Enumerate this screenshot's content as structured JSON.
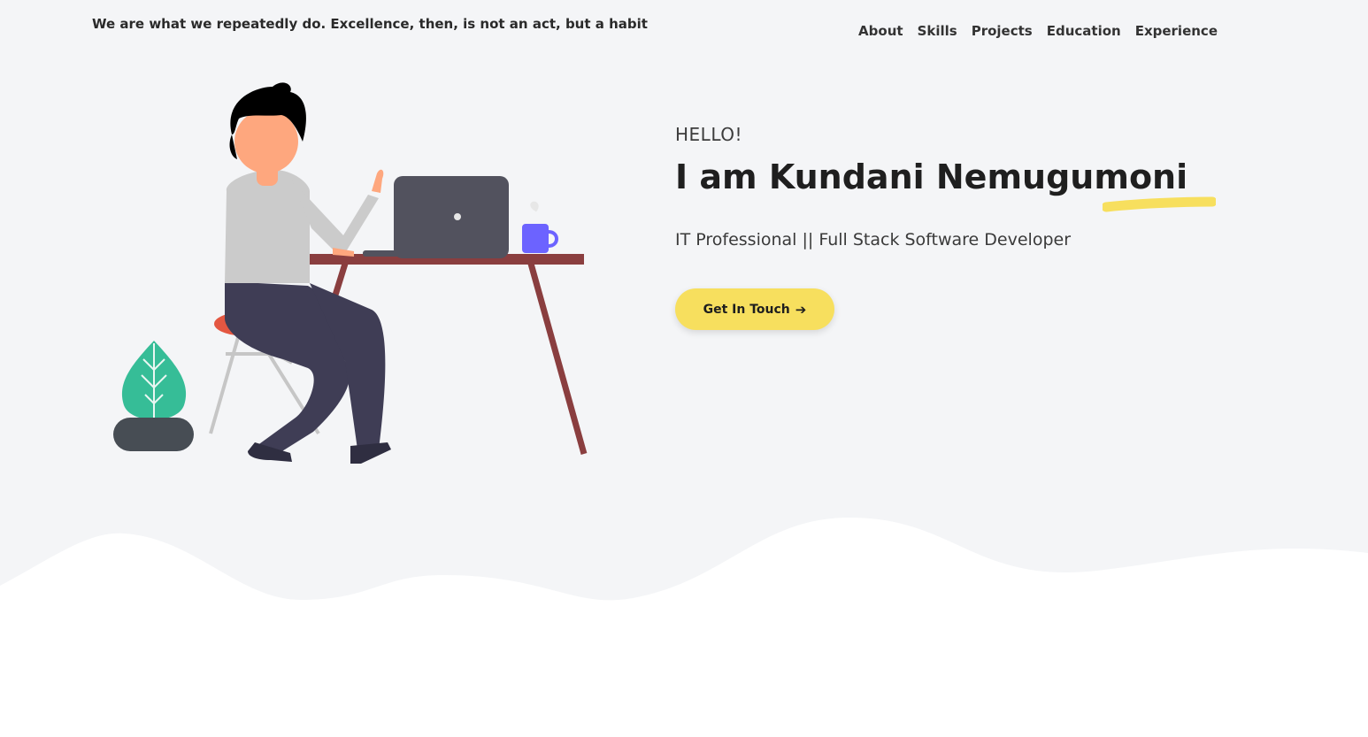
{
  "header": {
    "quote": "We are what we repeatedly do. Excellence, then, is not an act, but a habit"
  },
  "nav": {
    "items": [
      "About",
      "Skills",
      "Projects",
      "Education",
      "Experience"
    ]
  },
  "hero": {
    "greeting": "HELLO!",
    "name": "I am Kundani Nemugumoni",
    "role": "IT Professional || Full Stack Software Developer",
    "cta_label": "Get In Touch",
    "cta_icon": "arrow-right-icon"
  },
  "colors": {
    "background": "#f4f5f7",
    "accent": "#f7df5e",
    "wave": "#ffffff"
  },
  "illustration": {
    "subject": "person-at-desk-icon"
  }
}
